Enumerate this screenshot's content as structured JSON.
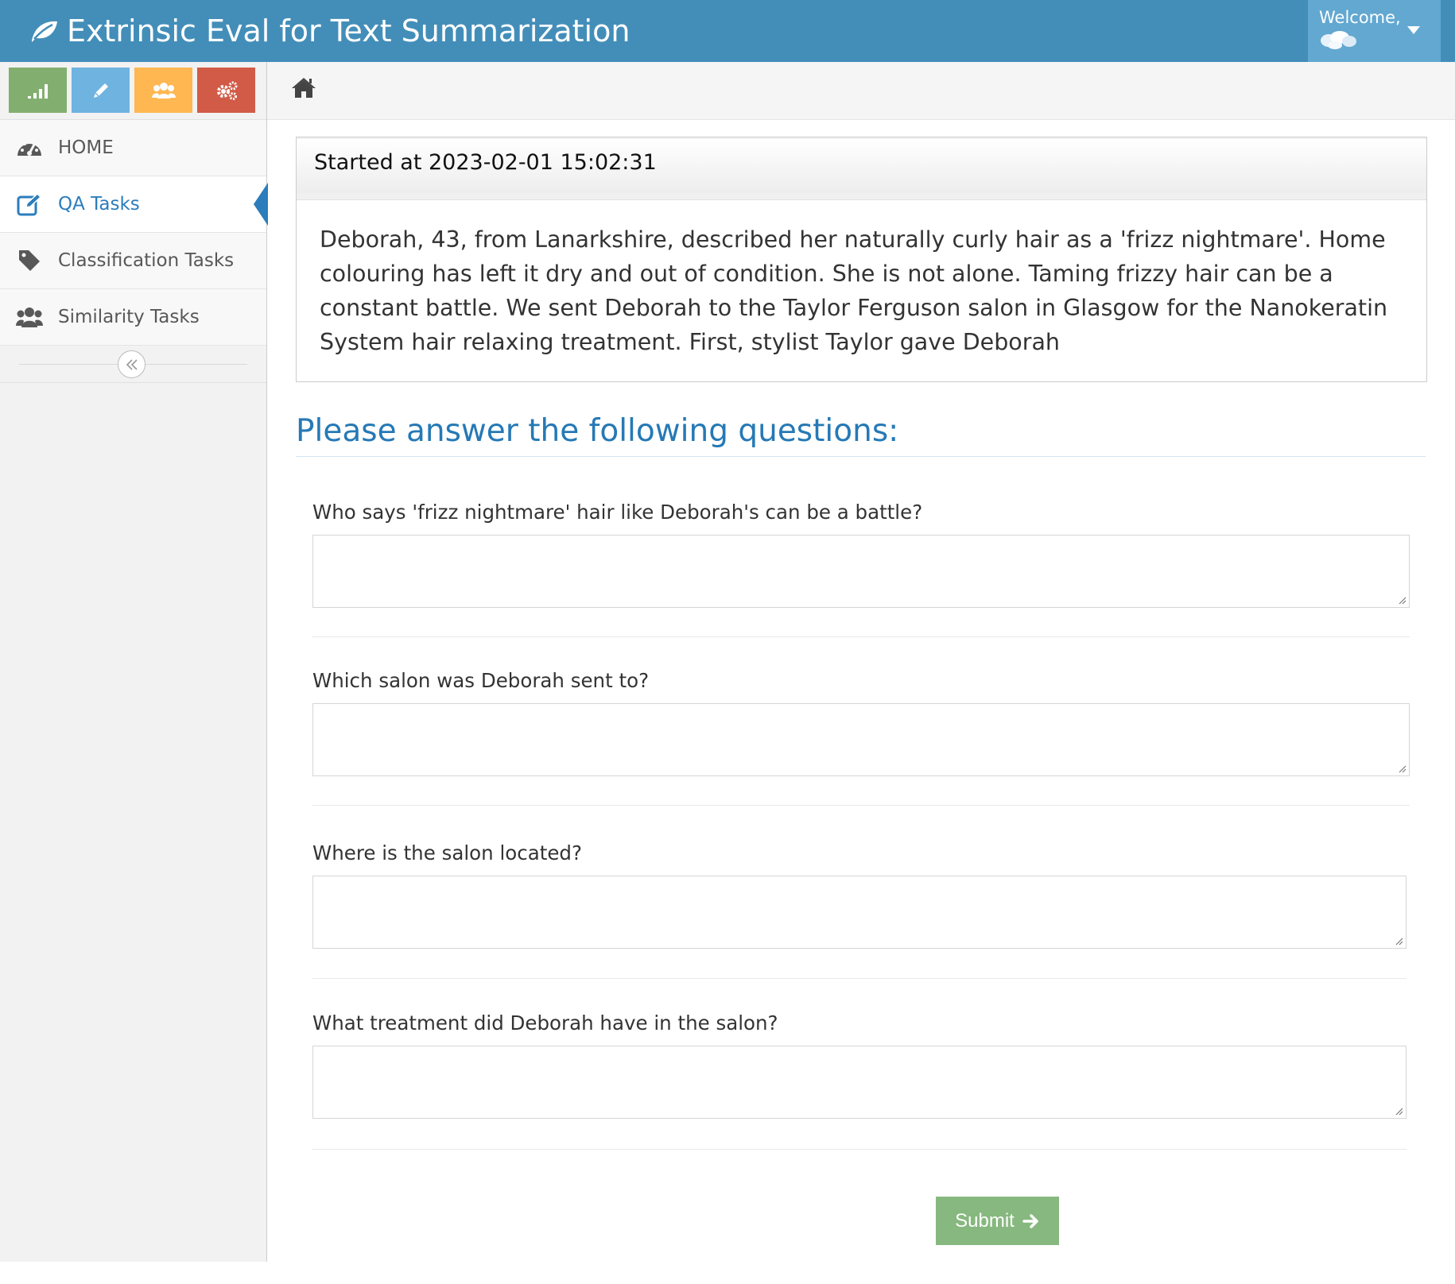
{
  "navbar": {
    "title": "Extrinsic Eval for Text Summarization",
    "welcome": "Welcome,"
  },
  "colors": {
    "navbar": "#438eb9",
    "user_menu": "#62a8d1",
    "shortcut_stats": "#82af6f",
    "shortcut_edit": "#6fb3e0",
    "shortcut_users": "#ffb752",
    "shortcut_settings": "#d15b47",
    "accent": "#2b7dbc",
    "submit": "#87b87f"
  },
  "shortcuts": [
    {
      "icon": "signal-icon"
    },
    {
      "icon": "pencil-icon"
    },
    {
      "icon": "users-icon"
    },
    {
      "icon": "cogs-icon"
    }
  ],
  "sidebar": {
    "items": [
      {
        "label": "HOME",
        "icon": "dashboard-icon",
        "active": false
      },
      {
        "label": "QA Tasks",
        "icon": "edit-icon",
        "active": true
      },
      {
        "label": "Classification Tasks",
        "icon": "tag-icon",
        "active": false
      },
      {
        "label": "Similarity Tasks",
        "icon": "users-icon",
        "active": false
      }
    ],
    "collapse_icon": "double-angle-left-icon"
  },
  "breadcrumb": {
    "icon": "home-icon"
  },
  "task": {
    "started_at": "Started at 2023-02-01 15:02:31",
    "article": "Deborah, 43, from Lanarkshire, described her naturally curly hair as a 'frizz nightmare'. Home colouring has left it dry and out of condition. She is not alone. Taming frizzy hair can be a constant battle. We sent Deborah to the Taylor Ferguson salon in Glasgow for the Nanokeratin System hair relaxing treatment. First, stylist Taylor gave Deborah"
  },
  "questions": {
    "heading": "Please answer the following questions:",
    "items": [
      {
        "label": "Who says 'frizz nightmare' hair like Deborah's can be a battle?",
        "value": ""
      },
      {
        "label": "Which salon was Deborah sent to?",
        "value": ""
      },
      {
        "label": "Where is the salon located?",
        "value": ""
      },
      {
        "label": "What treatment did Deborah have in the salon?",
        "value": ""
      }
    ]
  },
  "submit": {
    "label": "Submit",
    "icon": "arrow-right-icon"
  }
}
